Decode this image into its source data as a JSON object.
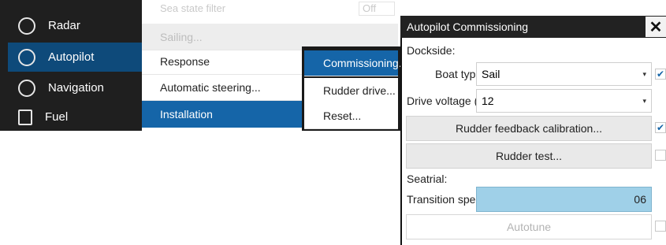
{
  "sidebar": {
    "items": [
      {
        "label": "Radar",
        "icon": "radar-icon"
      },
      {
        "label": "Autopilot",
        "icon": "steering-wheel-icon"
      },
      {
        "label": "Navigation",
        "icon": "compass-icon"
      },
      {
        "label": "Fuel",
        "icon": "fuel-pump-icon"
      }
    ],
    "active_index": 1
  },
  "menu": {
    "partial_top": "Sea state filter",
    "partial_top_value": "Off",
    "items": [
      "Sailing...",
      "Response",
      "Automatic steering...",
      "Installation"
    ],
    "selected": "Installation"
  },
  "submenu": {
    "items": [
      "Commissioning...",
      "Rudder drive...",
      "Reset..."
    ],
    "selected": "Commissioning..."
  },
  "dialog": {
    "title": "Autopilot Commissioning",
    "dockside_label": "Dockside:",
    "boat_type_label": "Boat type",
    "boat_type_value": "Sail",
    "drive_voltage_label": "Drive voltage (V)",
    "drive_voltage_value": "12",
    "rudder_feedback_button": "Rudder feedback calibration...",
    "rudder_test_button": "Rudder test...",
    "seatrial_label": "Seatrial:",
    "transition_speed_label": "Transition speed",
    "transition_speed_value": "06",
    "autotune_button": "Autotune"
  },
  "colors": {
    "accent": "#1565a8",
    "sidebar_bg": "#1f1f1f",
    "speed_field": "#9fd0e8"
  }
}
